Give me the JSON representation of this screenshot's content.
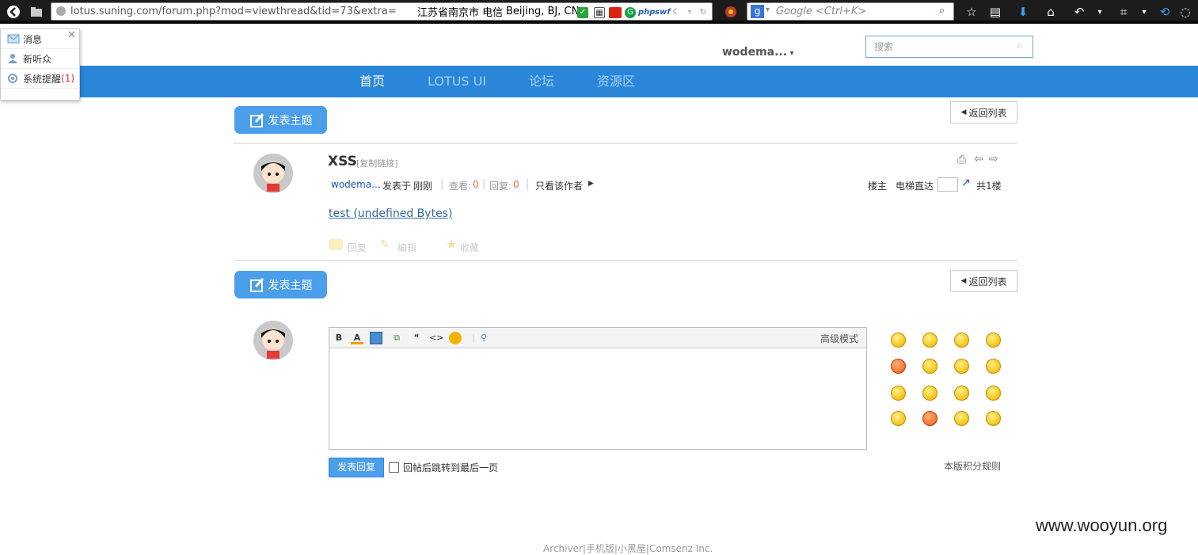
{
  "browser": {
    "url": "lotus.suning.com/forum.php?mod=viewthread&tid=73&extra=",
    "geo_location": "江苏省南京市 电信",
    "geo_city": "Beijing, BJ, CN",
    "search_placeholder": "Google <Ctrl+K>",
    "badge_php": "php",
    "badge_swf": "swf"
  },
  "notifications": {
    "items": [
      {
        "label": "消息"
      },
      {
        "label": "新听众"
      },
      {
        "label": "系统提醒",
        "count": "(1)"
      }
    ]
  },
  "header": {
    "username": "wodema...",
    "search_placeholder": "搜索"
  },
  "nav": {
    "items": [
      "首页",
      "LOTUS UI",
      "论坛",
      "资源区"
    ]
  },
  "actions": {
    "post_topic": "发表主题",
    "back_to_list": "返回列表"
  },
  "thread": {
    "title": "XSS",
    "copy_link": "[复制链接]",
    "author": "wodema...",
    "posted_prefix": "发表于",
    "posted_time": "刚刚",
    "views_label": "查看:",
    "views": "0",
    "replies_label": "回复:",
    "replies": "0",
    "only_author": "只看该作者",
    "floor_owner": "楼主",
    "elevator": "电梯直达",
    "total_floors": "共1楼",
    "attachment": "test (undefined Bytes)",
    "reply_btn": "回复",
    "edit_btn": "编辑",
    "fav_btn": "收藏"
  },
  "editor": {
    "advanced_mode": "高级模式",
    "submit": "发表回复",
    "jump_last": "回帖后跳转到最后一页",
    "credit_rules": "本版积分规则"
  },
  "footer": {
    "links": "Archiver|手机版|小黑屋|Comsenz Inc."
  },
  "watermark": "www.wooyun.org",
  "colors": {
    "nav_bg": "#2986d9",
    "primary_btn": "#4a9eea",
    "link": "#336699",
    "count_orange": "#f26c4f"
  }
}
